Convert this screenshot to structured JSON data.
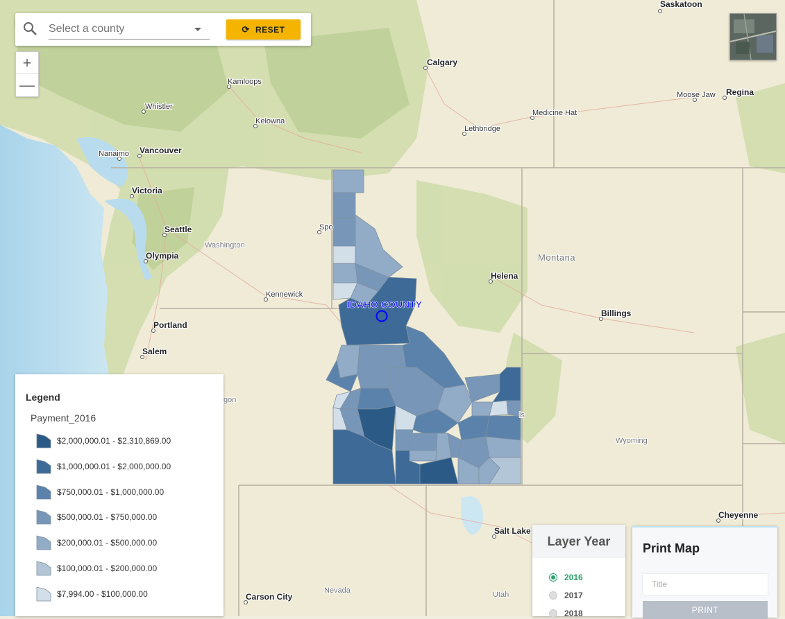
{
  "search": {
    "placeholder": "Select a county",
    "reset_label": "RESET"
  },
  "zoom": {
    "in_label": "+",
    "out_label": "—"
  },
  "map": {
    "cities": [
      {
        "name": "Saskatoon"
      },
      {
        "name": "Calgary"
      },
      {
        "name": "Kamloops"
      },
      {
        "name": "Whistler"
      },
      {
        "name": "Kelowna"
      },
      {
        "name": "Medicine Hat"
      },
      {
        "name": "Moose Jaw"
      },
      {
        "name": "Regina"
      },
      {
        "name": "Lethbridge"
      },
      {
        "name": "Nanaimo"
      },
      {
        "name": "Vancouver"
      },
      {
        "name": "Victoria"
      },
      {
        "name": "Seattle"
      },
      {
        "name": "Olympia"
      },
      {
        "name": "Spo"
      },
      {
        "name": "Kennewick"
      },
      {
        "name": "Helena"
      },
      {
        "name": "Billings"
      },
      {
        "name": "Portland"
      },
      {
        "name": "Salem"
      },
      {
        "name": "Salt Lake City"
      },
      {
        "name": "Cheyenne"
      },
      {
        "name": "Carson City"
      }
    ],
    "regions": [
      {
        "name": "Washington"
      },
      {
        "name": "Montana"
      },
      {
        "name": "Wyoming"
      },
      {
        "name": "Nevada"
      },
      {
        "name": "Utah"
      },
      {
        "name": "gon"
      },
      {
        "name": "ls"
      }
    ],
    "selected_county": "IDAHO COUNTY",
    "highlight_color": "#0000ff"
  },
  "legend": {
    "title": "Legend",
    "layer_name": "Payment_2016",
    "classes": [
      {
        "label": "$2,000,000.01 - $2,310,869.00",
        "color": "#2c5a86"
      },
      {
        "label": "$1,000,000.01 - $2,000,000.00",
        "color": "#3d6a97"
      },
      {
        "label": "$750,000.01 - $1,000,000.00",
        "color": "#5a82ab"
      },
      {
        "label": "$500,000.01 - $750,000.00",
        "color": "#7897b8"
      },
      {
        "label": "$200,000.01 - $500,000.00",
        "color": "#92abc6"
      },
      {
        "label": "$100,000.01 - $200,000.00",
        "color": "#b2c6d8"
      },
      {
        "label": "$7,994.00 - $100,000.00",
        "color": "#d2dfe9"
      }
    ]
  },
  "layer_year": {
    "title": "Layer Year",
    "options": [
      {
        "label": "2016",
        "selected": true
      },
      {
        "label": "2017",
        "selected": false
      },
      {
        "label": "2018",
        "selected": false
      }
    ]
  },
  "print": {
    "title": "Print Map",
    "title_placeholder": "Title",
    "button_label": "PRINT"
  }
}
